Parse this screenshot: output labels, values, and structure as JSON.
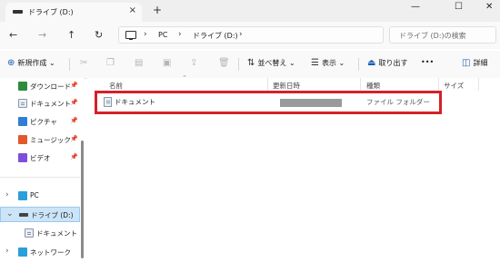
{
  "tab": {
    "title": "ドライブ (D:)",
    "close": "×",
    "new_tab": "+"
  },
  "window_controls": {
    "minimize": "—",
    "maximize": "☐",
    "close": "✕"
  },
  "nav": {
    "back": "←",
    "forward": "→",
    "up": "↑",
    "refresh": "↻"
  },
  "breadcrumb": {
    "sep": "›",
    "items": [
      "PC",
      "ドライブ (D:)"
    ]
  },
  "search": {
    "placeholder": "ドライブ (D:)の検索"
  },
  "command_bar": {
    "new_label": "新規作成",
    "new_caret": "⌄",
    "sort_label": "並べ替え",
    "view_label": "表示",
    "eject_label": "取り出す",
    "more": "•••",
    "details_label": "詳細"
  },
  "sidebar": {
    "quick": [
      {
        "label": "ダウンロード",
        "icon": "download-icon"
      },
      {
        "label": "ドキュメント",
        "icon": "documents-icon"
      },
      {
        "label": "ピクチャ",
        "icon": "pictures-icon"
      },
      {
        "label": "ミュージック",
        "icon": "music-icon"
      },
      {
        "label": "ビデオ",
        "icon": "videos-icon"
      }
    ],
    "pin": "📌",
    "tree": [
      {
        "label": "PC",
        "expander": "›"
      },
      {
        "label": "ドライブ (D:)",
        "expander": "⌄"
      },
      {
        "label": "ドキュメント"
      },
      {
        "label": "ネットワーク",
        "expander": "›"
      }
    ]
  },
  "file_list": {
    "columns": [
      "名前",
      "更新日時",
      "種類",
      "サイズ"
    ],
    "rows": [
      {
        "name": "ドキュメント",
        "type": "ファイル フォルダー"
      }
    ]
  },
  "colors": {
    "accent": "#1a5fb4",
    "highlight_border": "#d6202a",
    "selection": "#cce4f7"
  }
}
